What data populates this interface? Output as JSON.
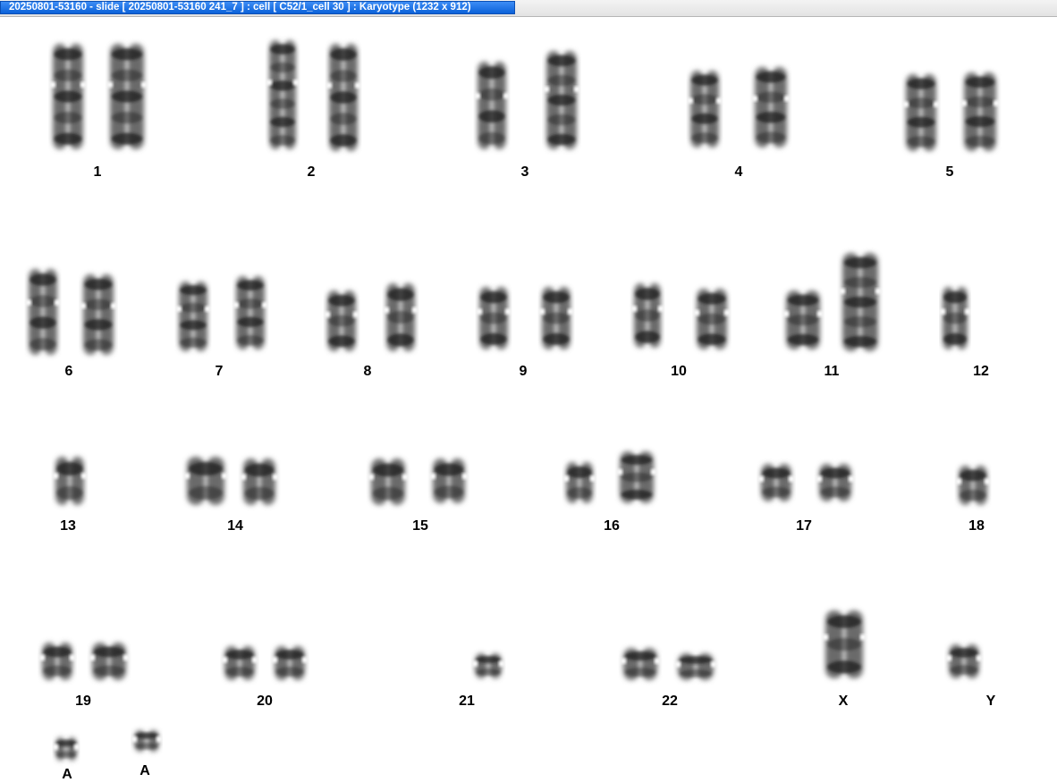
{
  "window": {
    "title": "20250801-53160 - slide [ 20250801-53160 241_7 ] : cell [ C52/1_cell 30 ] : Karyotype  (1232 x 912)"
  },
  "karyotype": {
    "labels": [
      "1",
      "2",
      "3",
      "4",
      "5",
      "6",
      "7",
      "8",
      "9",
      "10",
      "11",
      "12",
      "13",
      "14",
      "15",
      "16",
      "17",
      "18",
      "19",
      "20",
      "21",
      "22",
      "X",
      "Y",
      "A",
      "A"
    ]
  }
}
